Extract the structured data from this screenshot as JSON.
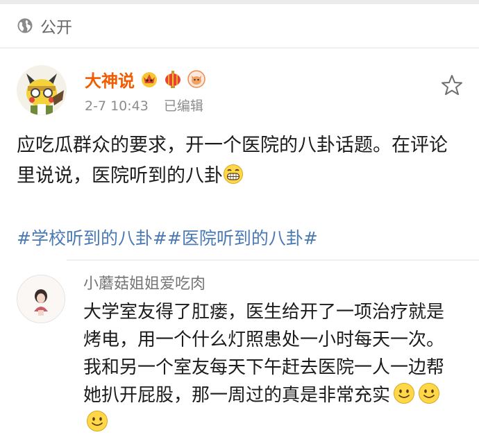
{
  "visibility": {
    "icon": "globe-icon",
    "label": "公开"
  },
  "post": {
    "author": {
      "name": "大神说",
      "name_color": "#f25c00",
      "badges": [
        "crown-badge-icon",
        "lantern-badge-icon",
        "fox-badge-icon"
      ]
    },
    "time": "2-7 10:43",
    "edited_label": "已编辑",
    "favorite_icon": "star-icon",
    "content": "应吃瓜群众的要求，开一个医院的八卦话题。在评论里说说，医院听到的八卦",
    "content_emoji": "grin-emoji",
    "hashtags": "#学校听到的八卦##医院听到的八卦#",
    "hashtag_color": "#4a7ab6"
  },
  "comment": {
    "author": "小蘑菇姐姐爱吃肉",
    "text": "大学室友得了肛瘘，医生给开了一项治疗就是烤电，用一个什么灯照患处一小时每天一次。我和另一个室友每天下午赶去医院一人一边帮她扒开屁股，那一周过的真是非常充实",
    "emojis": [
      "smile-emoji",
      "smile-emoji",
      "smile-emoji"
    ]
  }
}
